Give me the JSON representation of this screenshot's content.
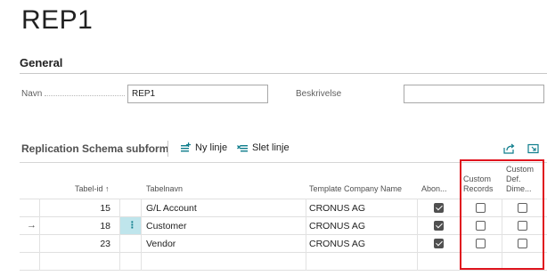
{
  "page": {
    "title": "REP1"
  },
  "general": {
    "header": "General",
    "name_label": "Navn",
    "name_value": "REP1",
    "description_label": "Beskrivelse",
    "description_value": ""
  },
  "subform": {
    "title": "Replication Schema subform",
    "new_line_label": "Ny linje",
    "delete_line_label": "Slet linje",
    "columns": {
      "table_id": "Tabel-id ↑",
      "table_name": "Tabelnavn",
      "template_company": "Template Company Name",
      "subscription": "Abon...",
      "custom_records_1": "Custom",
      "custom_records_2": "Records",
      "custom_def_1": "Custom",
      "custom_def_2": "Def.",
      "custom_def_3": "Dime..."
    },
    "rows": [
      {
        "table_id": "15",
        "table_name": "G/L Account",
        "company": "CRONUS AG",
        "subscription": true,
        "custom_records": false,
        "custom_def": false,
        "current": false
      },
      {
        "table_id": "18",
        "table_name": "Customer",
        "company": "CRONUS AG",
        "subscription": true,
        "custom_records": false,
        "custom_def": false,
        "current": true
      },
      {
        "table_id": "23",
        "table_name": "Vendor",
        "company": "CRONUS AG",
        "subscription": true,
        "custom_records": false,
        "custom_def": false,
        "current": false
      }
    ],
    "row_menu_glyph": "⋮",
    "current_row_arrow": "→"
  },
  "colors": {
    "highlight": "#e0141e",
    "selected_cell": "#bfe5ec",
    "accent": "#0e7d8c"
  }
}
